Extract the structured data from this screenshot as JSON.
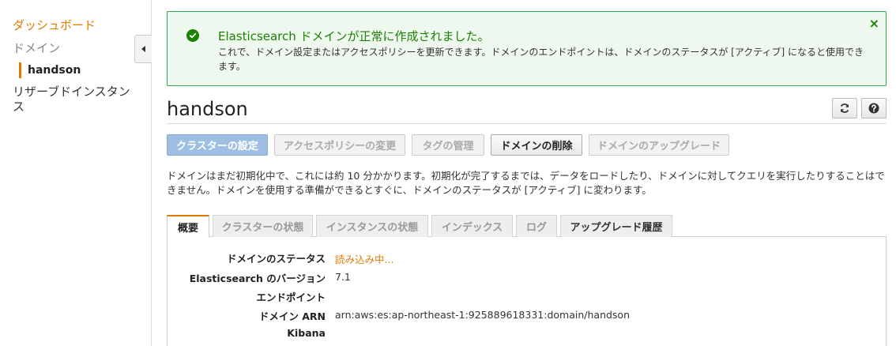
{
  "sidebar": {
    "dashboard": "ダッシュボード",
    "domain": "ドメイン",
    "selected_domain": "handson",
    "reserved_instances": "リザーブドインスタンス"
  },
  "alert": {
    "title": "Elasticsearch ドメインが正常に作成されました。",
    "body": "これで、ドメイン設定またはアクセスポリシーを更新できます。ドメインのエンドポイントは、ドメインのステータスが [アクティブ] になると使用できます。",
    "close": "×",
    "color": "#1d8102"
  },
  "header": {
    "title": "handson"
  },
  "actions": {
    "configure_cluster": "クラスターの設定",
    "modify_access_policy": "アクセスポリシーの変更",
    "manage_tags": "タグの管理",
    "delete_domain": "ドメインの削除",
    "upgrade_domain": "ドメインのアップグレード"
  },
  "info": "ドメインはまだ初期化中で、これには約 10 分かかります。初期化が完了するまでは、データをロードしたり、ドメインに対してクエリを実行したりすることはできません。ドメインを使用する準備ができるとすぐに、ドメインのステータスが [アクティブ] に変わります。",
  "tabs": {
    "overview": "概要",
    "cluster_health": "クラスターの状態",
    "instance_health": "インスタンスの状態",
    "indices": "インデックス",
    "logs": "ログ",
    "upgrade_history": "アップグレード履歴"
  },
  "details": {
    "status_label": "ドメインのステータス",
    "status_value": "読み込み中...",
    "version_label": "Elasticsearch のバージョン",
    "version_value": "7.1",
    "endpoint_label": "エンドポイント",
    "endpoint_value": "",
    "arn_label": "ドメイン ARN",
    "arn_value": "arn:aws:es:ap-northeast-1:925889618331:domain/handson",
    "kibana_label": "Kibana",
    "kibana_value": ""
  },
  "icons": {
    "success": "check-circle-icon",
    "close": "close-icon",
    "refresh": "refresh-icon",
    "help": "help-icon",
    "collapse": "caret-left-icon"
  },
  "colors": {
    "accent": "#e07b00",
    "success": "#1d8102",
    "primary_button": "#9fbfe2"
  }
}
